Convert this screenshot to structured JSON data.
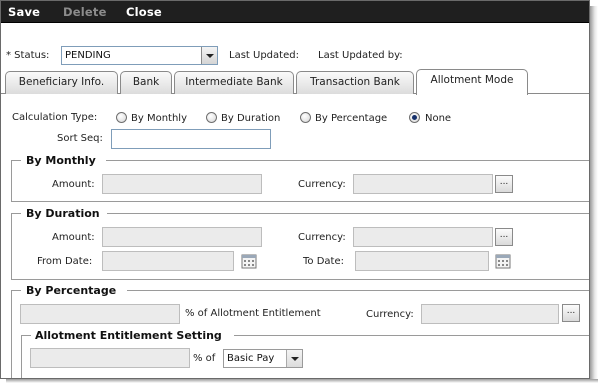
{
  "toolbar": {
    "save": "Save",
    "delete": "Delete",
    "close": "Close"
  },
  "status_row": {
    "status_label": "* Status:",
    "status_value": "PENDING",
    "last_updated_label": "Last Updated:",
    "last_updated_by_label": "Last Updated by:"
  },
  "tabs": [
    {
      "label": "Beneficiary Info."
    },
    {
      "label": "Bank"
    },
    {
      "label": "Intermediate Bank"
    },
    {
      "label": "Transaction Bank"
    },
    {
      "label": "Allotment Mode",
      "active": true
    }
  ],
  "calc": {
    "label": "Calculation Type:",
    "options": [
      "By Monthly",
      "By Duration",
      "By Percentage",
      "None"
    ],
    "selected": "None",
    "sort_seq_label": "Sort Seq:"
  },
  "by_monthly": {
    "title": "By Monthly",
    "amount_label": "Amount:",
    "currency_label": "Currency:",
    "ellipsis": "..."
  },
  "by_duration": {
    "title": "By Duration",
    "amount_label": "Amount:",
    "currency_label": "Currency:",
    "from_date_label": "From Date:",
    "to_date_label": "To Date:",
    "ellipsis": "..."
  },
  "by_percentage": {
    "title": "By Percentage",
    "pct_label": "% of Allotment Entitlement",
    "currency_label": "Currency:",
    "ellipsis": "...",
    "setting_title": "Allotment Entitlement Setting",
    "pct_of_label": "% of",
    "basis_value": "Basic Pay"
  },
  "colors": {
    "toolbar_bg": "#1f1f1f",
    "radio_dot": "#15306b",
    "input_border": "#7f9db9",
    "disabled_bg": "#ebebeb"
  }
}
